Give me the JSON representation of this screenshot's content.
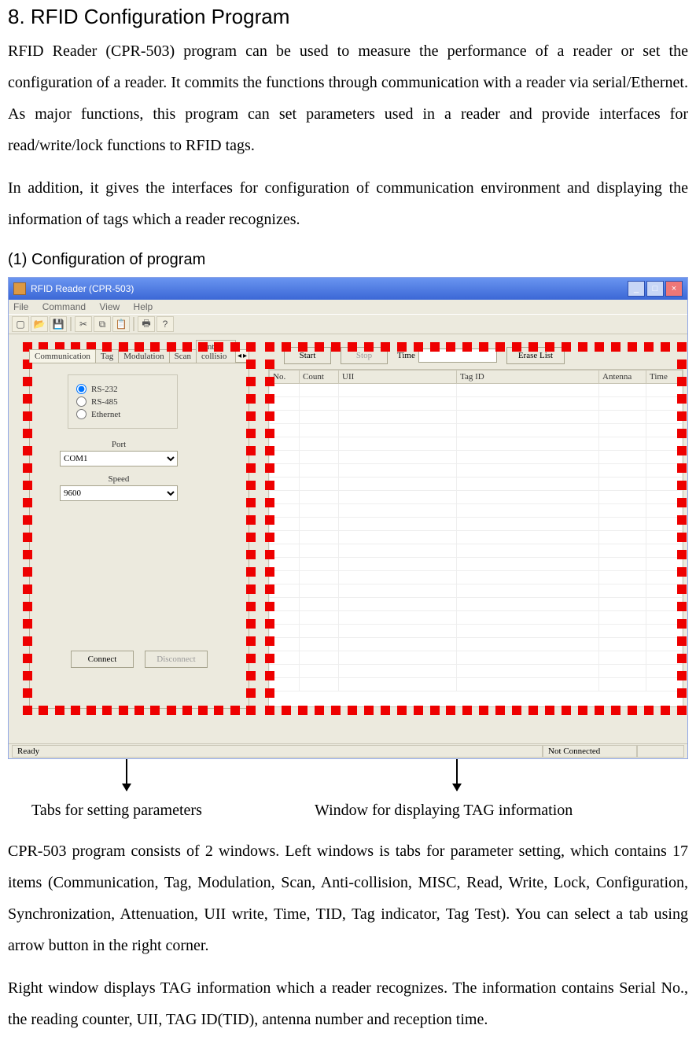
{
  "heading": "8. RFID Configuration Program",
  "para1": "RFID Reader (CPR-503) program can be used to measure the performance of a reader or set the configuration of a reader. It commits the functions through communication with a reader via serial/Ethernet. As major functions, this program can set parameters used in a reader and provide interfaces for read/write/lock functions to RFID tags.",
  "para2": "In addition, it gives the interfaces for configuration of communication environment and displaying the information of tags which a reader recognizes.",
  "subheading": "(1) Configuration of program",
  "window": {
    "title": "RFID Reader (CPR-503)",
    "menus": [
      "File",
      "Command",
      "View",
      "Help"
    ],
    "tabs": [
      "Communication",
      "Tag",
      "Modulation",
      "Scan",
      "Anti-collisio"
    ],
    "radios": [
      "RS-232",
      "RS-485",
      "Ethernet"
    ],
    "port_label": "Port",
    "port_value": "COM1",
    "speed_label": "Speed",
    "speed_value": "9600",
    "connect": "Connect",
    "disconnect": "Disconnect",
    "start": "Start",
    "stop": "Stop",
    "time_label": "Time",
    "erase": "Erase List",
    "columns": [
      "No.",
      "Count",
      "UII",
      "Tag ID",
      "Antenna",
      "Time"
    ],
    "status_left": "Ready",
    "status_right": "Not Connected"
  },
  "caption_left": "Tabs for setting parameters",
  "caption_right": "Window for displaying TAG information",
  "para3": "CPR-503 program consists of 2 windows. Left windows is tabs for parameter setting, which contains 17 items (Communication, Tag, Modulation, Scan, Anti-collision, MISC, Read, Write, Lock, Configuration, Synchronization, Attenuation, UII write, Time, TID, Tag indicator, Tag Test). You can select a tab using arrow button in the right corner.",
  "para4": "Right window displays TAG information which a reader recognizes. The information contains Serial No., the reading counter, UII, TAG ID(TID), antenna number and reception time."
}
